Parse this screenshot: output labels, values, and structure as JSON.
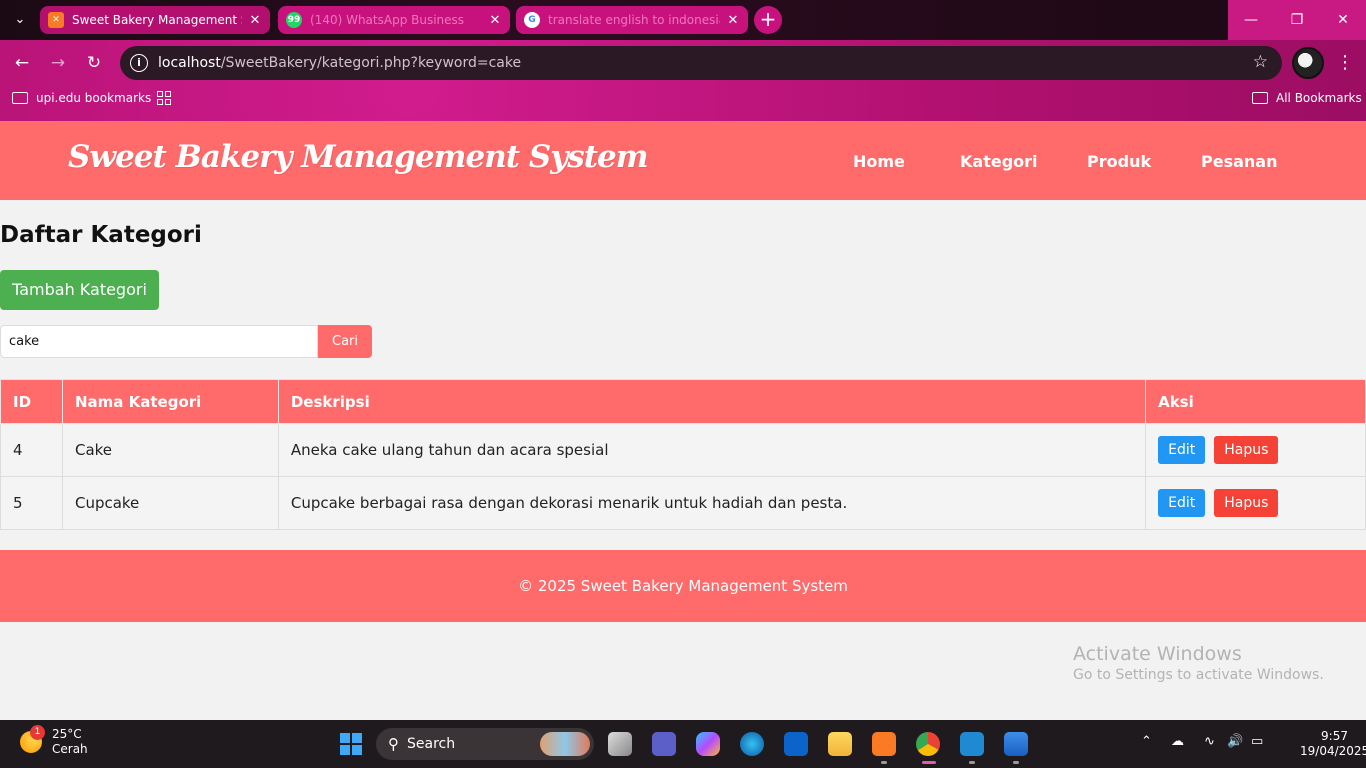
{
  "browser": {
    "tabs": [
      {
        "title": "Sweet Bakery Management Sys",
        "active": true
      },
      {
        "title": "(140) WhatsApp Business",
        "active": false
      },
      {
        "title": "translate english to indonesia",
        "active": false
      }
    ],
    "new_tab_label": "+",
    "address": {
      "host": "localhost",
      "path": "/SweetBakery/kategori.php?keyword=cake"
    },
    "bookmarks": {
      "left_label": "upi.edu bookmarks",
      "right_label": "All Bookmarks"
    }
  },
  "site": {
    "brand": "Sweet Bakery Management System",
    "nav": [
      "Home",
      "Kategori",
      "Produk",
      "Pesanan"
    ],
    "footer": "© 2025 Sweet Bakery Management System"
  },
  "main": {
    "title": "Daftar Kategori",
    "add_button": "Tambah Kategori",
    "search": {
      "value": "cake",
      "button": "Cari"
    },
    "table": {
      "headers": [
        "ID",
        "Nama Kategori",
        "Deskripsi",
        "Aksi"
      ],
      "rows": [
        {
          "id": "4",
          "name": "Cake",
          "description": "Aneka cake ulang tahun dan acara spesial"
        },
        {
          "id": "5",
          "name": "Cupcake",
          "description": "Cupcake berbagai rasa dengan dekorasi menarik untuk hadiah dan pesta."
        }
      ],
      "edit_label": "Edit",
      "delete_label": "Hapus"
    }
  },
  "watermark": {
    "line1": "Activate Windows",
    "line2": "Go to Settings to activate Windows."
  },
  "taskbar": {
    "weather": {
      "temp": "25°C",
      "condition": "Cerah",
      "badge": "1"
    },
    "search_label": "Search",
    "time": "9:57",
    "date": "19/04/2025"
  },
  "colors": {
    "header": "#ff6b6b",
    "add_button": "#4caf50",
    "edit": "#2196f3",
    "delete": "#f44336"
  }
}
